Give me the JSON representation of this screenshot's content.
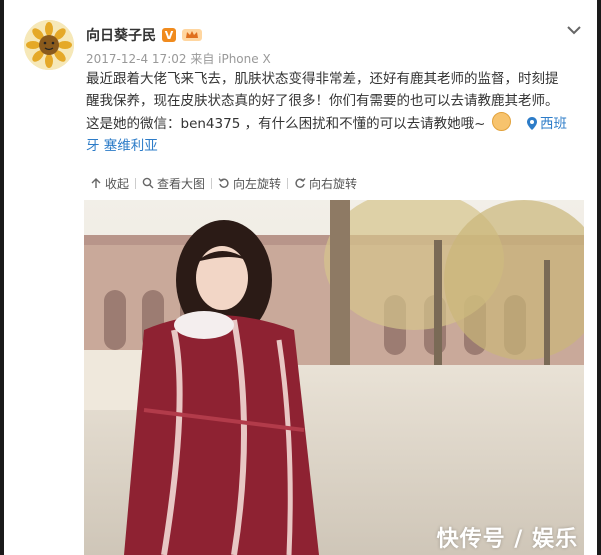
{
  "post": {
    "username": "向日葵子民",
    "verified_badge": "V",
    "meta": "2017-12-4 17:02 来自 iPhone X",
    "text_line1": "最近跟着大佬飞来飞去，肌肤状态变得非常差，还好有鹿其老师的监督，时刻提",
    "text_line2": "醒我保养，现在皮肤状态真的好了很多！你们有需要的也可以去请教鹿其老师。",
    "text_line3a": "这是她的微信：ben4375 ，有什么困扰和不懂的可以去请教她哦~",
    "location_a": "西班",
    "location_b": "牙 塞维利亚"
  },
  "toolbar": {
    "collapse": "收起",
    "view_large": "查看大图",
    "rotate_left": "向左旋转",
    "rotate_right": "向右旋转"
  },
  "watermark": "快传号 / 娱乐",
  "icons": {
    "avatar": "sunflower-avatar",
    "badge": "verified-v-icon",
    "vip": "vip-crown-icon",
    "more": "chevron-down-icon",
    "emoji": "smile-emoji-icon",
    "location": "location-pin-icon"
  },
  "colors": {
    "link": "#2d7cc8",
    "badge": "#f08b1e",
    "scarf": "#8e2232"
  }
}
